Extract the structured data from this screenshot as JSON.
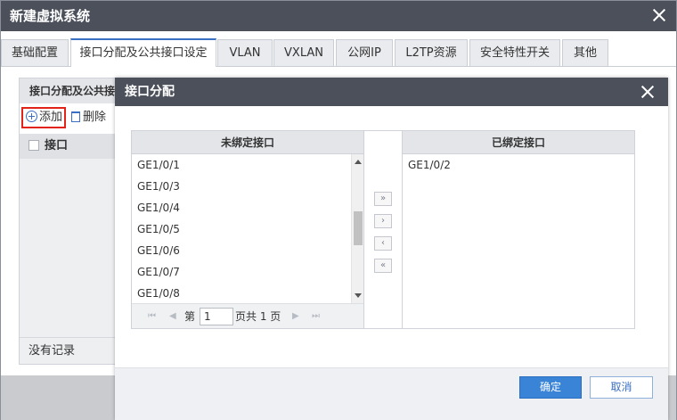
{
  "window": {
    "title": "新建虚拟系统"
  },
  "tabs": [
    {
      "label": "基础配置"
    },
    {
      "label": "接口分配及公共接口设定"
    },
    {
      "label": "VLAN"
    },
    {
      "label": "VXLAN"
    },
    {
      "label": "公网IP"
    },
    {
      "label": "L2TP资源"
    },
    {
      "label": "安全特性开关"
    },
    {
      "label": "其他"
    }
  ],
  "panel": {
    "title": "接口分配及公共接口设定",
    "add_label": "添加",
    "delete_label": "删除",
    "column_header": "接口",
    "empty_text": "没有记录"
  },
  "modal": {
    "title": "接口分配",
    "unbound": {
      "header": "未绑定接口",
      "items": [
        "GE1/0/1",
        "GE1/0/3",
        "GE1/0/4",
        "GE1/0/5",
        "GE1/0/6",
        "GE1/0/7",
        "GE1/0/8"
      ]
    },
    "bound": {
      "header": "已绑定接口",
      "items": [
        "GE1/0/2"
      ]
    },
    "pager": {
      "prefix": "第",
      "page": "1",
      "suffix": "页共 1 页"
    },
    "move_buttons": [
      "»",
      "›",
      "‹",
      "«"
    ],
    "ok_label": "确定",
    "cancel_label": "取消"
  },
  "colors": {
    "title_bar": "#4b505b",
    "accent": "#3a84d8",
    "highlight_border": "#e2231a"
  }
}
